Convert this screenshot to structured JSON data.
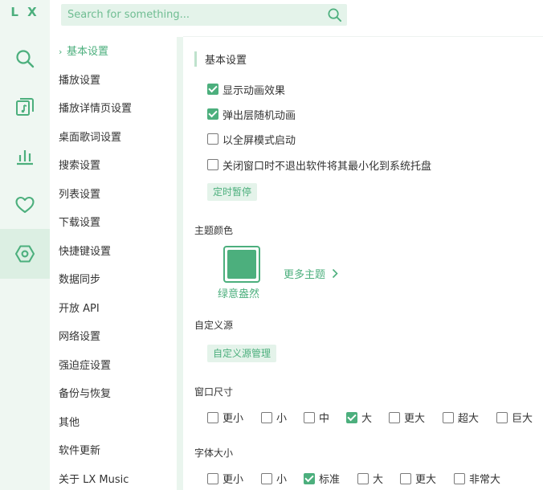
{
  "app": {
    "logo": "L X"
  },
  "rail": [
    {
      "name": "search",
      "icon": "search-icon"
    },
    {
      "name": "song-list",
      "icon": "music-note-icon"
    },
    {
      "name": "leaderboard",
      "icon": "bar-chart-icon"
    },
    {
      "name": "my-list",
      "icon": "heart-icon"
    },
    {
      "name": "settings",
      "icon": "hexagon-gear-icon",
      "active": true
    }
  ],
  "search": {
    "placeholder": "Search for something...",
    "value": ""
  },
  "nav": {
    "items": [
      {
        "label": "基本设置",
        "active": true
      },
      {
        "label": "播放设置"
      },
      {
        "label": "播放详情页设置"
      },
      {
        "label": "桌面歌词设置"
      },
      {
        "label": "搜索设置"
      },
      {
        "label": "列表设置"
      },
      {
        "label": "下载设置"
      },
      {
        "label": "快捷键设置"
      },
      {
        "label": "数据同步"
      },
      {
        "label": "开放 API"
      },
      {
        "label": "网络设置"
      },
      {
        "label": "强迫症设置"
      },
      {
        "label": "备份与恢复"
      },
      {
        "label": "其他"
      },
      {
        "label": "软件更新"
      },
      {
        "label": "关于 LX Music"
      }
    ]
  },
  "basic": {
    "title": "基本设置",
    "options": [
      {
        "label": "显示动画效果",
        "checked": true
      },
      {
        "label": "弹出层随机动画",
        "checked": true
      },
      {
        "label": "以全屏模式启动",
        "checked": false
      },
      {
        "label": "关闭窗口时不退出软件将其最小化到系统托盘",
        "checked": false
      }
    ],
    "timer_button": "定时暂停"
  },
  "theme": {
    "title": "主题颜色",
    "current_label": "绿意盎然",
    "current_color": "#4caf7d",
    "more_label": "更多主题"
  },
  "source": {
    "title": "自定义源",
    "manage_button": "自定义源管理"
  },
  "window_size": {
    "title": "窗口尺寸",
    "options": [
      {
        "label": "更小",
        "checked": false
      },
      {
        "label": "小",
        "checked": false
      },
      {
        "label": "中",
        "checked": false
      },
      {
        "label": "大",
        "checked": true
      },
      {
        "label": "更大",
        "checked": false
      },
      {
        "label": "超大",
        "checked": false
      },
      {
        "label": "巨大",
        "checked": false
      }
    ]
  },
  "font_size": {
    "title": "字体大小",
    "options": [
      {
        "label": "更小",
        "checked": false
      },
      {
        "label": "小",
        "checked": false
      },
      {
        "label": "标准",
        "checked": true
      },
      {
        "label": "大",
        "checked": false
      },
      {
        "label": "更大",
        "checked": false
      },
      {
        "label": "非常大",
        "checked": false
      }
    ]
  },
  "colors": {
    "accent": "#4caf7d",
    "rail_bg": "#eff7f2",
    "chip_bg": "#e4f3ea"
  }
}
